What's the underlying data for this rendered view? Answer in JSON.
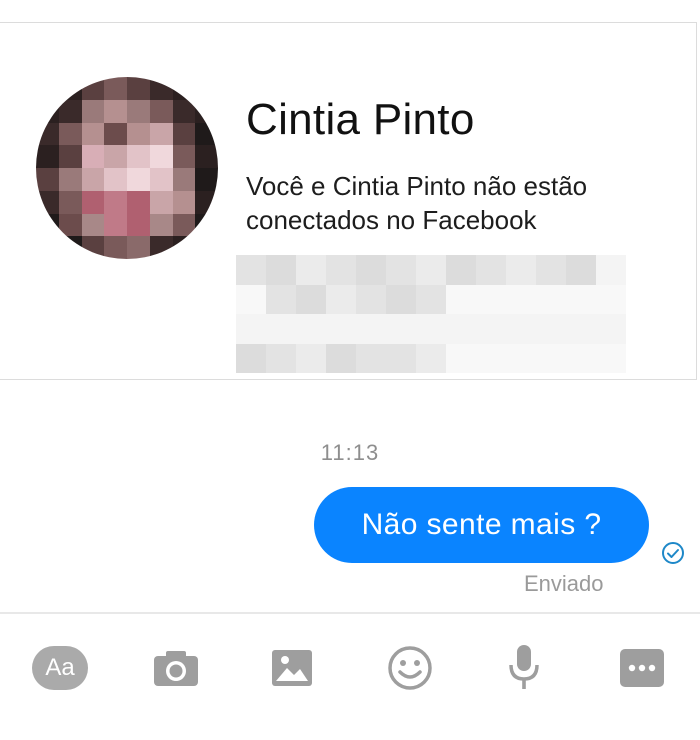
{
  "contact": {
    "name": "Cintia Pinto",
    "notice": "Você e Cintia Pinto não estão conectados no Facebook"
  },
  "conversation": {
    "timestamp": "11:13",
    "message": "Não sente mais ?",
    "status": "Enviado"
  },
  "composer": {
    "aa_label": "Aa",
    "icons": [
      "camera-icon",
      "image-icon",
      "emoji-icon",
      "microphone-icon",
      "more-icon"
    ]
  },
  "colors": {
    "bubble": "#0a84ff",
    "icon_gray": "#9e9e9e"
  }
}
